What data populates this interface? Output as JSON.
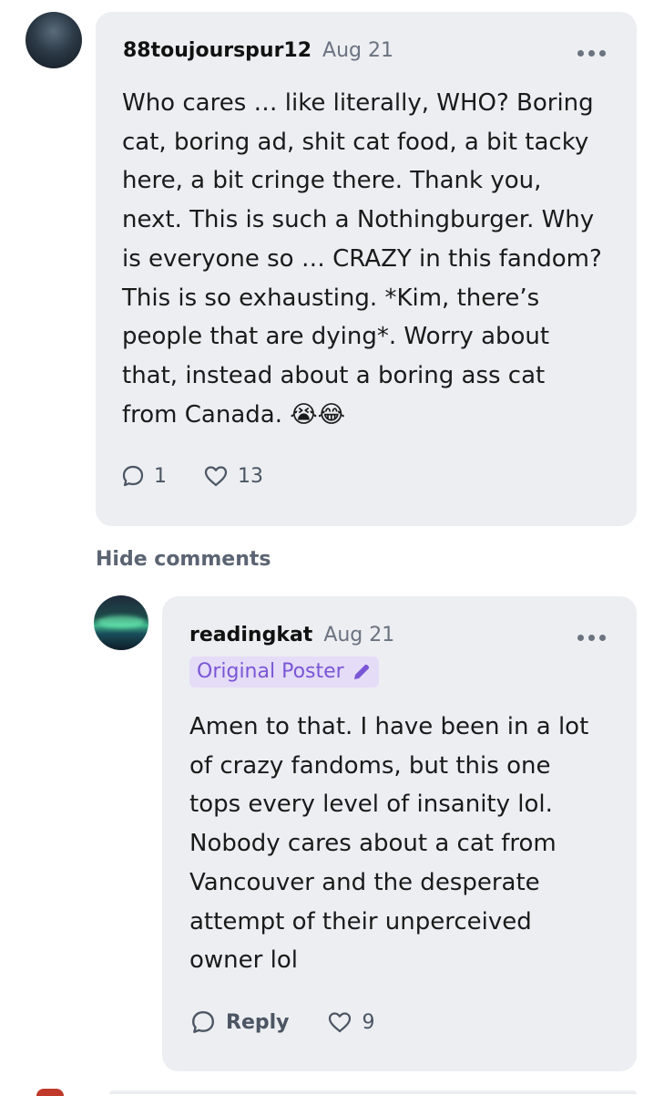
{
  "comments": [
    {
      "username": "88toujourspur12",
      "date": "Aug 21",
      "avatar_text": "",
      "text": "Who cares … like literally, WHO? Boring\ncat, boring ad, shit cat food, a bit tacky\nhere, a bit cringe there. Thank you,\nnext. This is such a Nothingburger. Why\nis everyone so … CRAZY in this fandom?\nThis is so exhausting. *Kim, there’s\npeople that  are dying*. Worry about\nthat, instead about a boring ass cat\nfrom Canada. 😭😂",
      "reply_count": "1",
      "like_count": "13"
    }
  ],
  "hide_comments_label": "Hide comments",
  "reply": {
    "username": "readingkat",
    "date": "Aug 21",
    "badge": "Original Poster",
    "text": "Amen to that.  I have been in a lot\nof crazy fandoms, but this one\ntops every level of insanity lol.\nNobody cares about a cat from\nVancouver and the desperate\nattempt of their unperceived\nowner lol",
    "reply_label": "Reply",
    "like_count": "9"
  },
  "colors": {
    "card_bg": "#eceef1",
    "badge_bg": "#e5dcf7",
    "badge_text": "#7a56d6",
    "muted": "#6b7280"
  }
}
